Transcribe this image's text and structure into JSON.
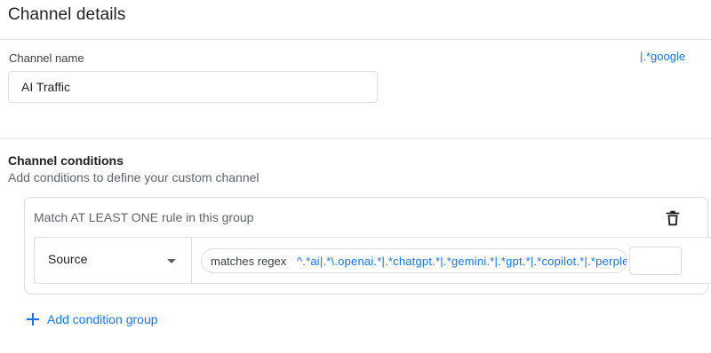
{
  "header": {
    "title": "Channel details"
  },
  "channel_name": {
    "label": "Channel name",
    "value": "AI Traffic"
  },
  "conditions": {
    "title": "Channel conditions",
    "subtitle": "Add conditions to define your custom channel",
    "group": {
      "header": "Match AT LEAST ONE rule in this group",
      "delete_icon": "trash-icon",
      "rule": {
        "dimension": "Source",
        "operator": "matches regex",
        "value": "^.*ai|.*\\.openai.*|.*chatgpt.*|.*gemini.*|.*gpt.*|.*copilot.*|.*perplexity.*",
        "value_overflow": "|.*google"
      }
    },
    "add_group_label": "Add condition group",
    "add_icon": "plus-icon"
  },
  "colors": {
    "accent": "#1a73e8",
    "border": "#dadce0",
    "text": "#202124",
    "muted": "#5f6368"
  }
}
